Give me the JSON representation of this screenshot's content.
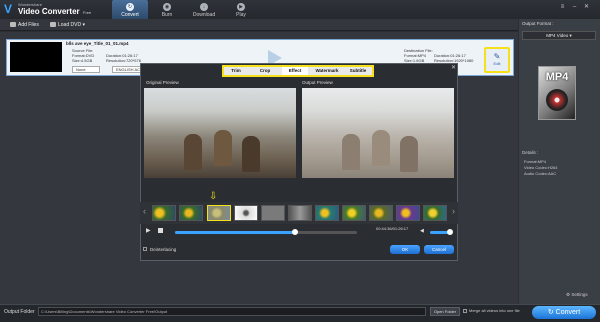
{
  "app": {
    "brand_line1": "Wondershare",
    "brand_line2": "Video Converter",
    "brand_line3": "Free"
  },
  "main_tabs": [
    {
      "label": "Convert",
      "icon": "refresh-icon"
    },
    {
      "label": "Burn",
      "icon": "disc-icon"
    },
    {
      "label": "Download",
      "icon": "download-icon"
    },
    {
      "label": "Play",
      "icon": "play-icon"
    }
  ],
  "toolbar": {
    "add_files": "Add Files",
    "load_dvd": "Load DVD"
  },
  "file": {
    "name": "blls ave eye_Title_01_01.mp4",
    "source_label": "Source File:",
    "source_format": "Format:DVD",
    "source_duration": "Duration:01:26:17",
    "source_size": "Size:4.5GB",
    "source_resolution": "Resolution:720*576",
    "dest_label": "Destination File:",
    "dest_format": "Format:MP4",
    "dest_duration": "Duration:01:26:17",
    "dest_size": "Size:1.6GB",
    "dest_resolution": "Resolution:1920*1080",
    "subtitle_select": "None",
    "audio_select": "ENGLISH AC3",
    "edit_label": "Edit"
  },
  "right_panel": {
    "output_format_label": "Output Format :",
    "selected_format": "MP4 Video",
    "badge_text": "MP4",
    "details_label": "Details :",
    "details": [
      "Format:MP4",
      "Video Codec:H264",
      "Audio Codec:AAC"
    ],
    "settings_label": "Settings"
  },
  "dialog": {
    "tabs": [
      "Trim",
      "Crop",
      "Effect",
      "Watermark",
      "Subtitle"
    ],
    "active_tab": "Effect",
    "original_preview": "Original Preview",
    "output_preview": "Output Preview",
    "timecode": "00:44:36/01:26:17",
    "deinterlacing": "Deinterlacing",
    "ok": "OK",
    "cancel": "Cancel"
  },
  "bottom": {
    "output_folder_label": "Output Folder",
    "output_path": "C:\\Users\\Billing\\Documents\\Wondershare Video Converter Free\\Output",
    "open_folder": "Open Folder",
    "merge_label": "Merge all videos into one file",
    "convert": "Convert"
  },
  "colors": {
    "accent": "#1c74d6",
    "highlight": "#f5e11a",
    "background": "#2b2e33"
  }
}
